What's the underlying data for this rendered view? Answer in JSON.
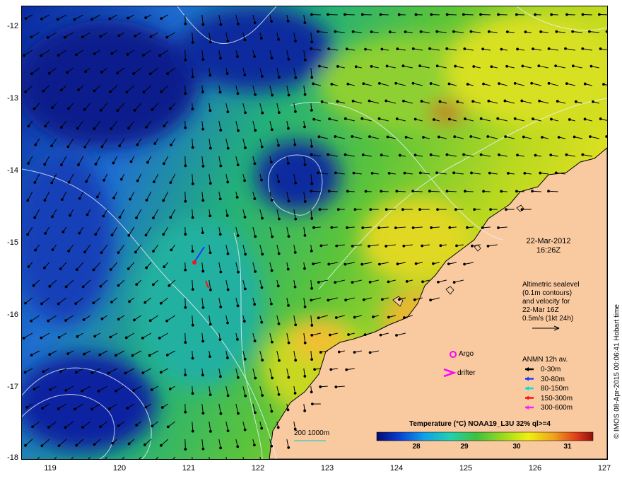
{
  "map": {
    "y_ticks": [
      "-12",
      "-13",
      "-14",
      "-15",
      "-16",
      "-17",
      "-18"
    ],
    "x_ticks": [
      "119",
      "120",
      "121",
      "122",
      "123",
      "124",
      "125",
      "126",
      "127"
    ],
    "date": "22-Mar-2012",
    "time": "16:26Z",
    "altimetry_lines": [
      "Altimetric sealevel",
      "(0.1m contours)",
      "and velocity for",
      "22-Mar 16Z",
      "0.5m/s (1kt 24h)"
    ],
    "argo_label": "Argo",
    "drifter_label": "drifter",
    "anmn_title": "ANMN 12h av.",
    "anmn_items": [
      {
        "label": "0-30m",
        "color": "#000000"
      },
      {
        "label": "30-80m",
        "color": "#1a3cff"
      },
      {
        "label": "80-150m",
        "color": "#00e0e0"
      },
      {
        "label": "150-300m",
        "color": "#ff1010"
      },
      {
        "label": "300-600m",
        "color": "#ff20ff"
      }
    ],
    "scale_label": "200  1000m",
    "colorbar_title": "Temperature (°C) NOAA19_L3U 32% ql>=4",
    "colorbar_ticks": [
      "28",
      "29",
      "30",
      "31"
    ],
    "credit": "© IMOS 08-Apr-2015 00:06:41 Hobart time",
    "colors": {
      "land": "#f9c9a0",
      "deep": "#0a1c8c",
      "argo": "#ff00ff",
      "drifter": "#ff00ff"
    }
  }
}
